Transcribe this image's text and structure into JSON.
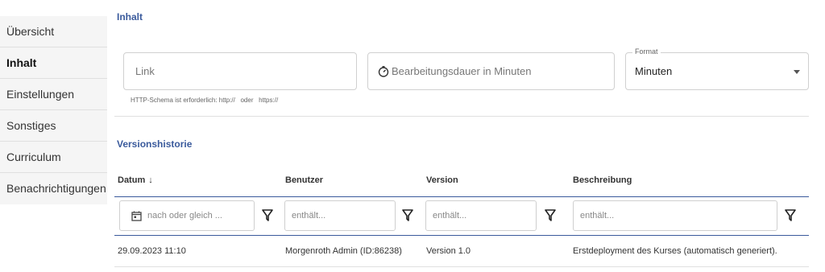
{
  "sidebar": {
    "items": [
      {
        "label": "Übersicht"
      },
      {
        "label": "Inhalt"
      },
      {
        "label": "Einstellungen"
      },
      {
        "label": "Sonstiges"
      },
      {
        "label": "Curriculum"
      },
      {
        "label": "Benachrichtigungen"
      }
    ]
  },
  "inhalt": {
    "title": "Inhalt",
    "link_placeholder": "Link",
    "link_hint": "HTTP-Schema ist erforderlich: http://   oder   https://",
    "duration_placeholder": "Bearbeitungsdauer in Minuten",
    "format_label": "Format",
    "format_value": "Minuten"
  },
  "versions": {
    "title": "Versionshistorie",
    "columns": {
      "datum": "Datum",
      "datum_sort": "↓",
      "benutzer": "Benutzer",
      "version": "Version",
      "beschreibung": "Beschreibung"
    },
    "filters": {
      "datum": "nach oder gleich ...",
      "benutzer": "enthält...",
      "version": "enthält...",
      "beschreibung": "enthält..."
    },
    "rows": [
      {
        "datum": "29.09.2023 11:10",
        "benutzer": "Morgenroth Admin (ID:86238)",
        "version": "Version 1.0",
        "beschreibung": "Erstdeployment des Kurses (automatisch generiert)."
      }
    ]
  },
  "colors": {
    "accent": "#3a5a9c",
    "sidebar_bg": "#f5f5f5"
  },
  "icons": {
    "timer": "timer-icon",
    "calendar": "calendar-icon",
    "filter": "filter-icon",
    "dropdown": "chevron-down-icon"
  }
}
